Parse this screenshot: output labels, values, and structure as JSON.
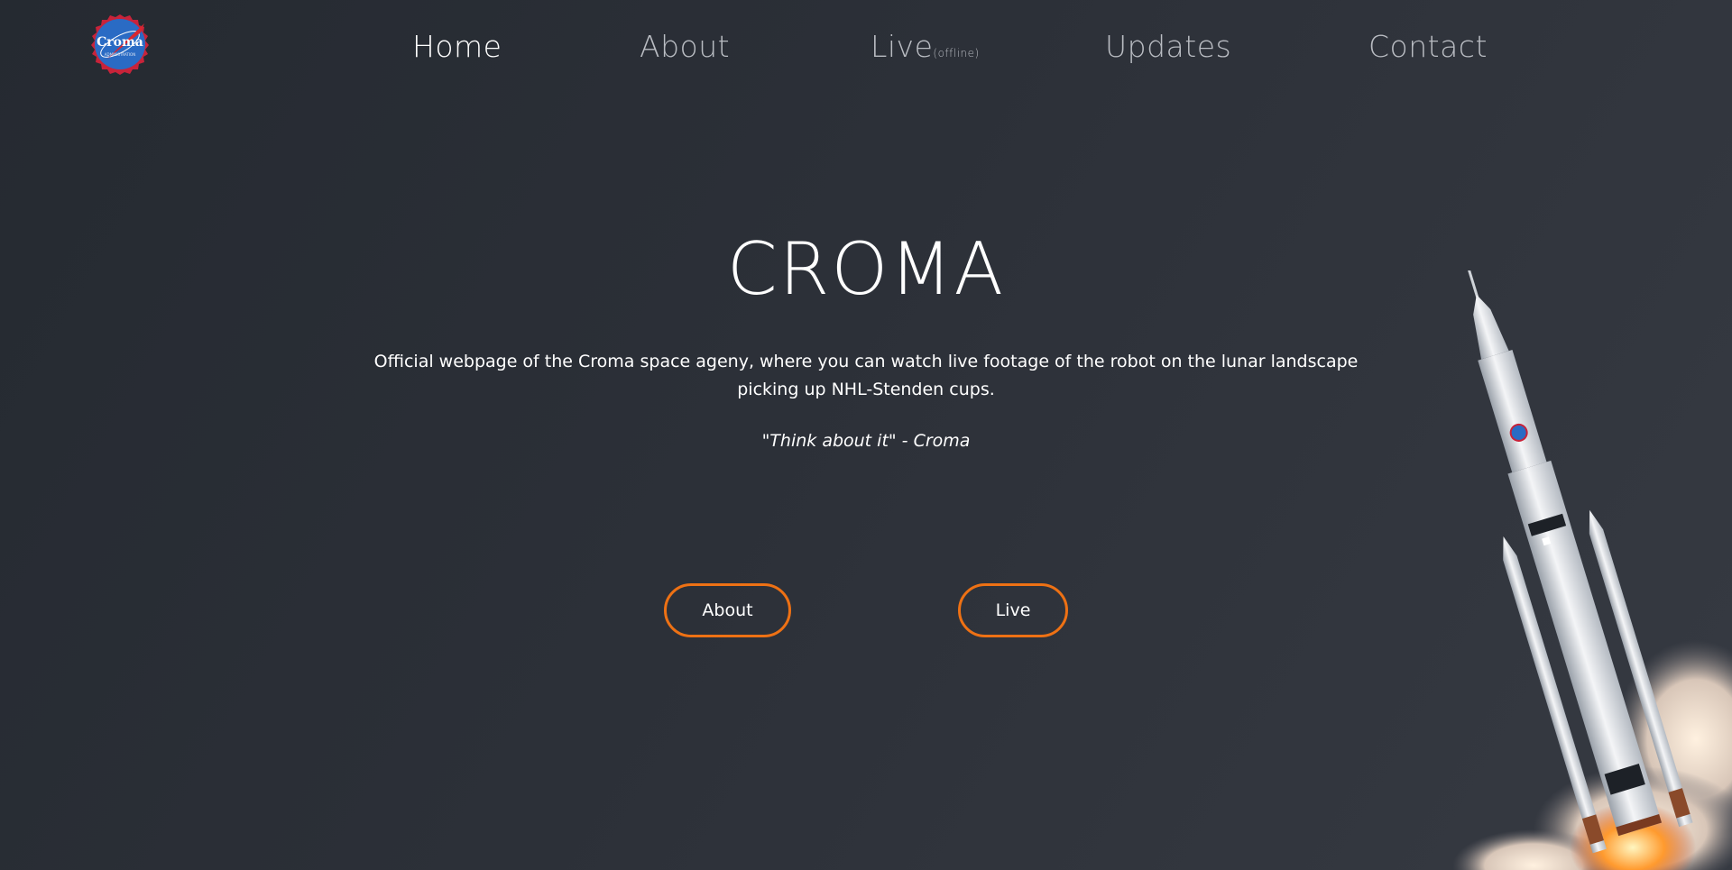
{
  "nav": {
    "logo_text": "Croma",
    "items": [
      {
        "label": "Home",
        "active": true
      },
      {
        "label": "About",
        "active": false
      },
      {
        "label": "Live",
        "sub": "(offline)",
        "active": false
      },
      {
        "label": "Updates",
        "active": false
      },
      {
        "label": "Contact",
        "active": false
      }
    ]
  },
  "hero": {
    "title": "CROMA",
    "description": "Official webpage of the Croma space ageny, where you can watch live footage of the robot on the lunar landscape picking up NHL-Stenden cups.",
    "quote": "\"Think about it\" - Croma"
  },
  "buttons": {
    "about_label": "About",
    "live_label": "Live"
  },
  "colors": {
    "accent": "#ee7114",
    "background": "#2c3038",
    "nav_inactive": "#b9bcc2"
  },
  "icons": {
    "logo": "croma-badge-icon",
    "hero_image": "rocket-launch-illustration"
  }
}
